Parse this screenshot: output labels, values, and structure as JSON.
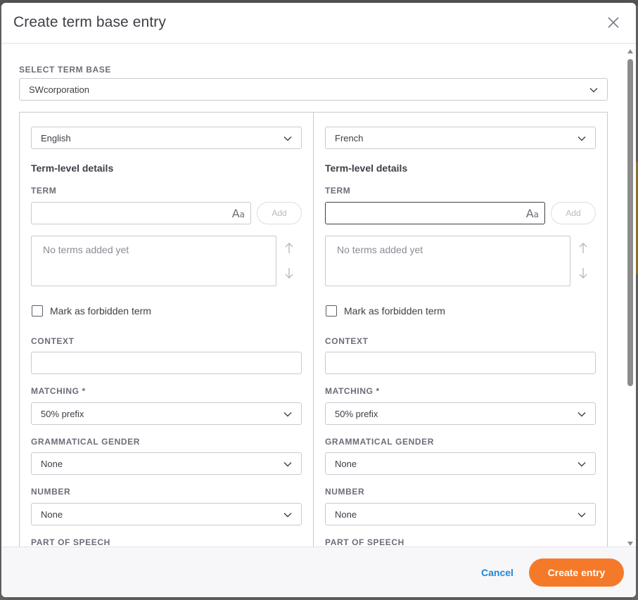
{
  "dialog": {
    "title": "Create term base entry",
    "close_icon": "close-icon"
  },
  "term_base": {
    "label": "SELECT TERM BASE",
    "value": "SWcorporation"
  },
  "panels": [
    {
      "language": "English",
      "section_title": "Term-level details",
      "term_label": "TERM",
      "term_value": "",
      "add_label": "Add",
      "terms_empty": "No terms added yet",
      "forbidden_label": "Mark as forbidden term",
      "forbidden_checked": false,
      "context_label": "CONTEXT",
      "context_value": "",
      "matching_label": "MATCHING *",
      "matching_value": "50% prefix",
      "gender_label": "GRAMMATICAL GENDER",
      "gender_value": "None",
      "number_label": "NUMBER",
      "number_value": "None",
      "pos_label": "PART OF SPEECH"
    },
    {
      "language": "French",
      "section_title": "Term-level details",
      "term_label": "TERM",
      "term_value": "",
      "add_label": "Add",
      "terms_empty": "No terms added yet",
      "forbidden_label": "Mark as forbidden term",
      "forbidden_checked": false,
      "context_label": "CONTEXT",
      "context_value": "",
      "matching_label": "MATCHING *",
      "matching_value": "50% prefix",
      "gender_label": "GRAMMATICAL GENDER",
      "gender_value": "None",
      "number_label": "NUMBER",
      "number_value": "None",
      "pos_label": "PART OF SPEECH"
    }
  ],
  "footer": {
    "cancel_label": "Cancel",
    "create_label": "Create entry"
  },
  "colors": {
    "accent": "#f47a2a",
    "link": "#1d87d8"
  }
}
